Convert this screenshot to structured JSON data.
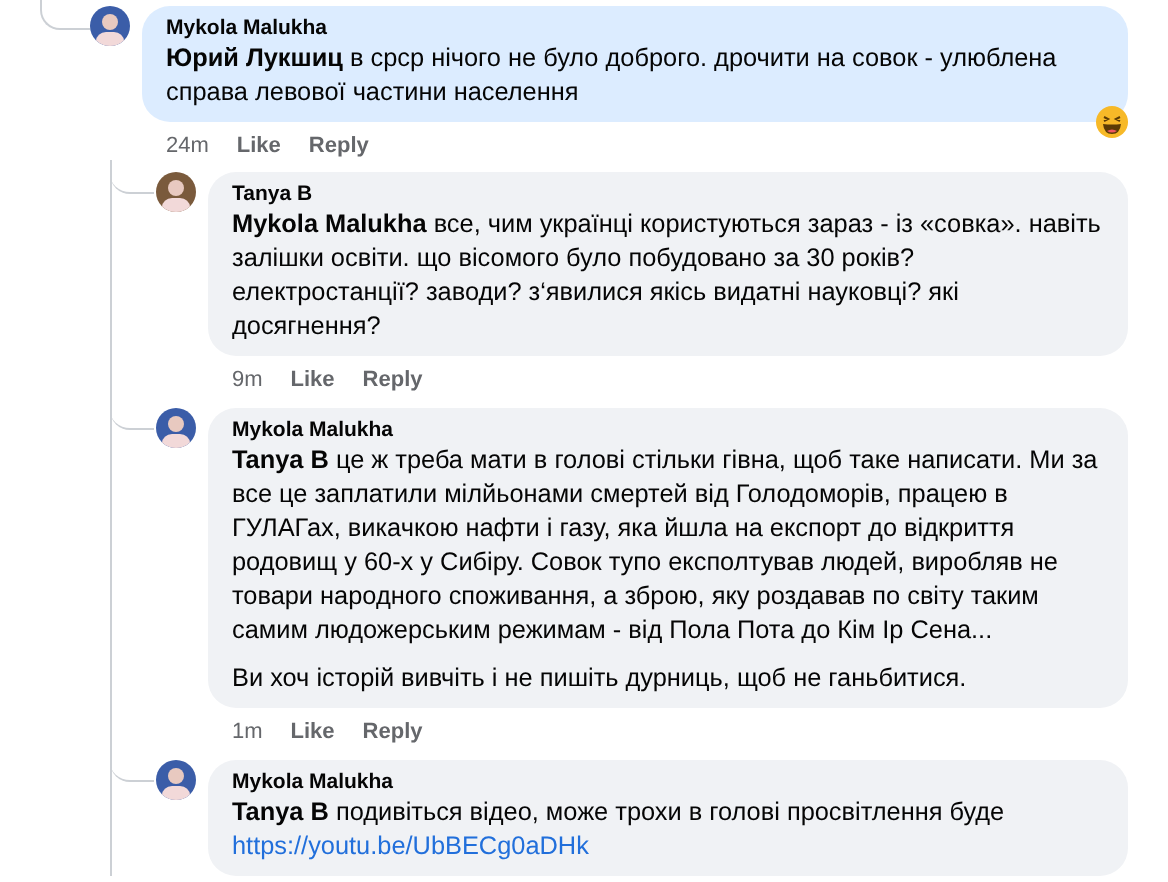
{
  "comments": [
    {
      "author": "Mykola Malukha",
      "color": "#3b5da8",
      "highlighted": true,
      "paragraphs": [
        "**Юрий Лукшиц** в срср нічого не було доброго. дрочити на совок - улюблена справа левової частини населення"
      ],
      "time": "24m",
      "like": "Like",
      "reply": "Reply",
      "reacted": true,
      "replies": [
        {
          "author": "Tanya B",
          "color": "#7a5a3c",
          "highlighted": false,
          "paragraphs": [
            "**Mykola Malukha** все, чим українці користуються зараз - із «совка». навіть залішки освіти. що вісомого було побудовано за 30 років? електростанції? заводи? з‘явилися якісь видатні науковці? які досягнення?"
          ],
          "time": "9m",
          "like": "Like",
          "reply": "Reply"
        },
        {
          "author": "Mykola Malukha",
          "color": "#3b5da8",
          "highlighted": false,
          "paragraphs": [
            "**Tanya B** це ж треба мати в голові стільки гівна, щоб таке написати. Ми за все це заплатили мілйьонами смертей від Голодоморів, працею в ГУЛАГах, викачкою нафти і газу, яка йшла на експорт до відкриття родовищ у 60-х у Сибіру. Совок тупо експолтував людей, виробляв не товари народного споживання, а зброю, яку роздавав по світу таким самим людожерським режимам - від Пола Пота до Кім Ір Сена...",
            "Ви хоч історій вивчіть і не пишіть дурниць, щоб не ганьбитися."
          ],
          "time": "1m",
          "like": "Like",
          "reply": "Reply"
        },
        {
          "author": "Mykola Malukha",
          "color": "#3b5da8",
          "highlighted": false,
          "paragraphs": [
            "**Tanya B** подивіться відео, може трохи в голові просвітлення буде"
          ],
          "link": "https://youtu.be/UbBECg0aDHk"
        }
      ]
    }
  ]
}
